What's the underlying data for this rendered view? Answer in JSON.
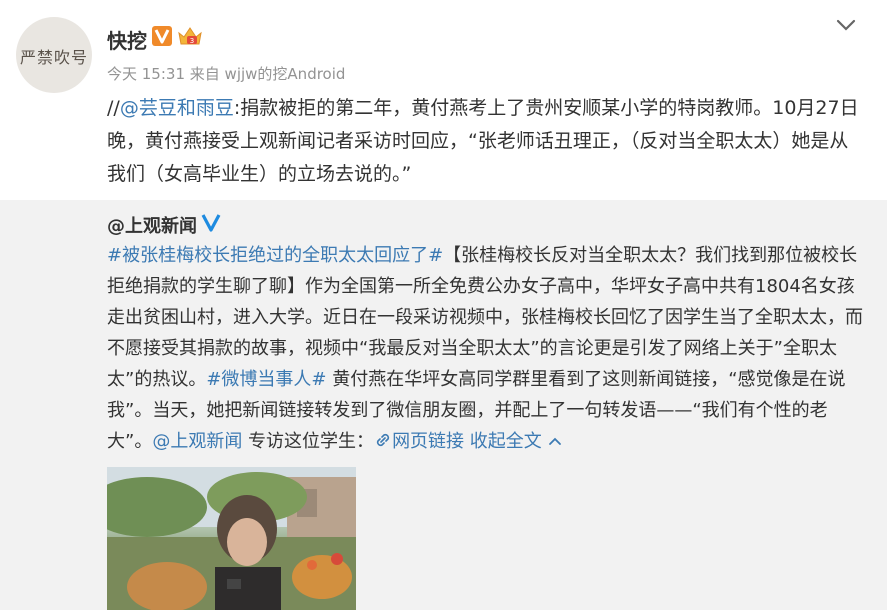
{
  "post": {
    "username": "快挖",
    "avatar_text": "严禁吹号",
    "time": "今天 15:31",
    "source": "来自 wjjw的挖Android",
    "text_prefix": "//",
    "mention": "@芸豆和雨豆",
    "text_body": ":捐款被拒的第二年，黄付燕考上了贵州安顺某小学的特岗教师。10月27日晚，黄付燕接受上观新闻记者采访时回应，“张老师话丑理正，（反对当全职太太）她是从我们（女高毕业生）的立场去说的。”"
  },
  "repost": {
    "user": "@上观新闻",
    "hashtag1": "#被张桂梅校长拒绝过的全职太太回应了#",
    "text1": "【张桂梅校长反对当全职太太？我们找到那位被校长拒绝捐款的学生聊了聊】作为全国第一所全免费公办女子高中，华坪女子高中共有1804名女孩走出贫困山村，进入大学。近日在一段采访视频中，张桂梅校长回忆了因学生当了全职太太，而不愿接受其捐款的故事，视频中“我最反对当全职太太”的言论更是引发了网络上关于”全职太太”的热议。",
    "hashtag2": "#微博当事人#",
    "text2": " 黄付燕在华坪女高同学群里看到了这则新闻链接，“感觉像是在说我”。当天，她把新闻链接转发到了微信朋友圈，并配上了一句转发语——“我们有个性的老大”。",
    "mention": "@上观新闻",
    "text3": " 专访这位学生：",
    "web_link_label": "网页链接",
    "collapse_label": "收起全文"
  },
  "colors": {
    "link": "#3c7ab3",
    "quote_bg": "#f2f2f2",
    "meta": "#939393"
  },
  "icons": {
    "verified_orange": "v-badge-icon",
    "crown": "crown-icon",
    "menu": "chevron-down-icon",
    "verified_blue": "blue-v-icon",
    "link": "link-icon",
    "collapse": "chevron-up-icon"
  }
}
